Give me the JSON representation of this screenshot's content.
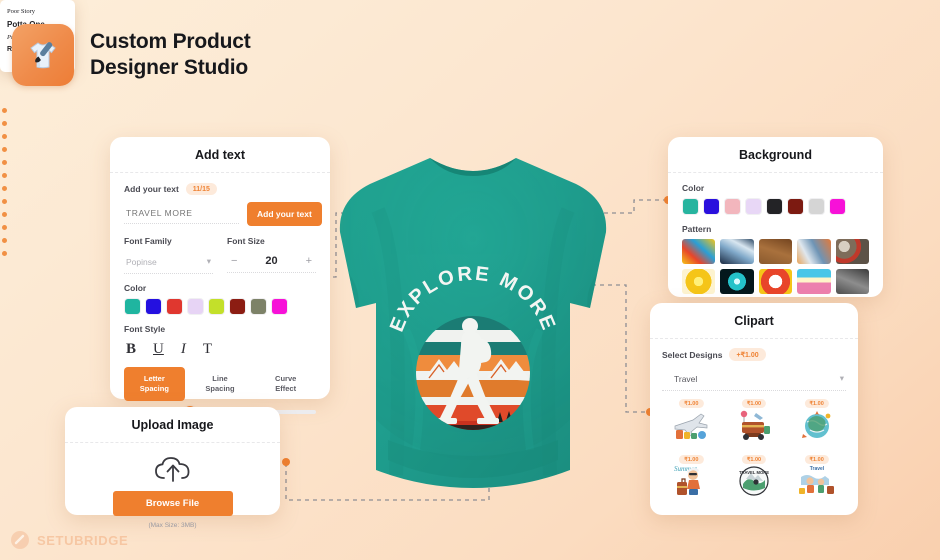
{
  "brand": {
    "title_line1": "Custom Product",
    "title_line2": "Designer Studio",
    "icon": "tshirt-paintbrush-icon"
  },
  "footer": {
    "logo_text": "SETUBRIDGE",
    "logo_icon": "setubridge-mark-icon"
  },
  "add_text_panel": {
    "title": "Add text",
    "text_label": "Add your text",
    "char_counter": "11/15",
    "input_value": "TRAVEL MORE",
    "input_placeholder": "TRAVEL MORE",
    "add_button": "Add your text",
    "font_family_label": "Font Family",
    "font_family_value": "Popinse",
    "font_size_label": "Font Size",
    "font_size_value": "20",
    "minus": "−",
    "plus": "+",
    "color_label": "Color",
    "colors": [
      "#1fb5a0",
      "#2410e0",
      "#e0372f",
      "#e7d4f5",
      "#c3e02a",
      "#8c1d13",
      "#7d8268",
      "#f711d8"
    ],
    "font_style_label": "Font Style",
    "font_styles": [
      {
        "glyph": "B",
        "name": "bold-button"
      },
      {
        "glyph": "U",
        "name": "underline-button"
      },
      {
        "glyph": "I",
        "name": "italic-button"
      },
      {
        "glyph": "T",
        "name": "text-transform-button"
      }
    ],
    "tabs": [
      {
        "line1": "Letter",
        "line2": "Spacing",
        "active": true
      },
      {
        "line1": "Line",
        "line2": "Spacing",
        "active": false
      },
      {
        "line1": "Curve",
        "line2": "Effect",
        "active": false
      }
    ]
  },
  "font_dropdown": {
    "options": [
      "Poor Story",
      "Potta One",
      "Pristina",
      "Rammetto One"
    ]
  },
  "upload_panel": {
    "title": "Upload Image",
    "icon": "cloud-upload-icon",
    "button": "Browse File",
    "hint": "(Max Size: 3MB)"
  },
  "background_panel": {
    "title": "Background",
    "color_label": "Color",
    "colors": [
      "#27b49f",
      "#2a10dd",
      "#f2b6bd",
      "#e8d7f6",
      "#232326",
      "#7c1a11",
      "#d5d5d5",
      "#f711d8"
    ],
    "pattern_label": "Pattern",
    "patterns": [
      "abstract-paint-splash",
      "blue-ice-texture",
      "brown-leather-texture",
      "orange-blue-marble",
      "stone-pebbles-texture",
      "yellow-burst-comic",
      "teal-light-burst",
      "red-comic-explosion",
      "pink-blue-sunset",
      "grey-concrete-texture"
    ]
  },
  "clipart_panel": {
    "title": "Clipart",
    "select_label": "Select Designs",
    "price_badge": "+₹1.00",
    "category_value": "Travel",
    "items": [
      {
        "name": "airplane-luggage-clipart",
        "price": "₹1.00"
      },
      {
        "name": "vintage-car-suitcase-clipart",
        "price": "₹1.00"
      },
      {
        "name": "world-travel-globe-clipart",
        "price": "₹1.00"
      },
      {
        "name": "summer-vacation-boy-clipart",
        "price": "₹1.00"
      },
      {
        "name": "travel-more-badge-clipart",
        "price": "₹1.00"
      },
      {
        "name": "travel-tips-family-clipart",
        "price": "₹1.00"
      }
    ]
  },
  "shirt": {
    "name": "teal-sweatshirt-mockup",
    "design_text": "EXPLORE MORE",
    "design_name": "explore-more-hiker-sunset-graphic",
    "base_color": "#1f9e8e"
  }
}
